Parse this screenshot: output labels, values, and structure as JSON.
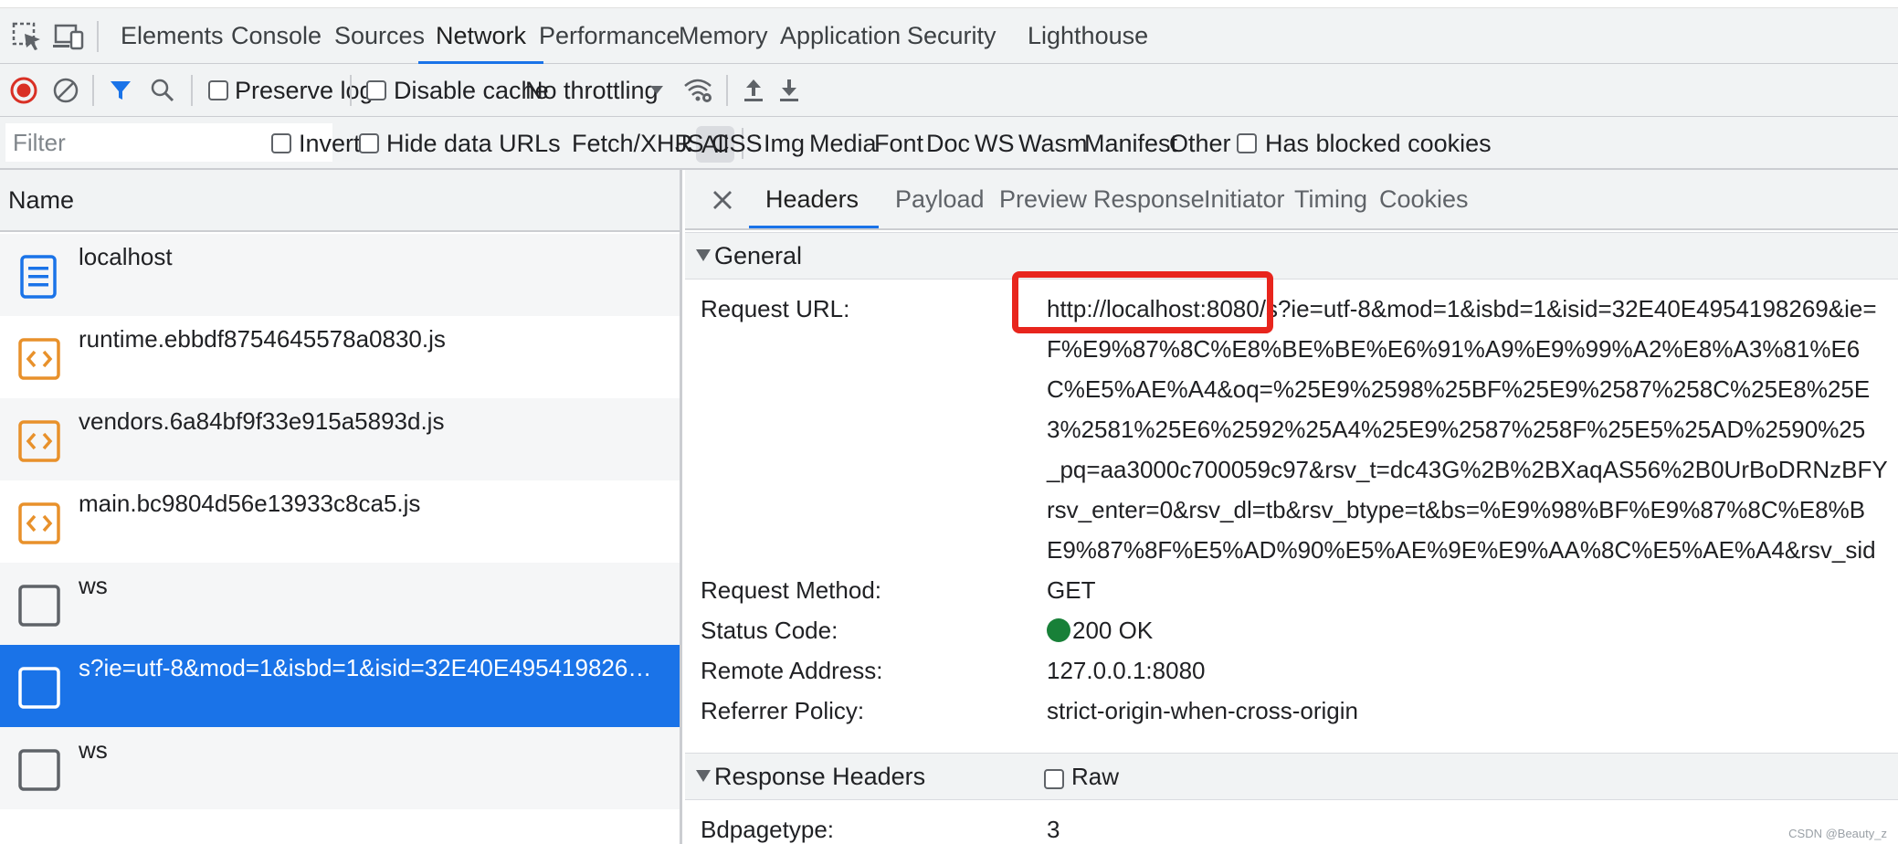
{
  "tabbar": {
    "tabs": [
      {
        "label": "Elements"
      },
      {
        "label": "Console"
      },
      {
        "label": "Sources"
      },
      {
        "label": "Network",
        "active": true
      },
      {
        "label": "Performance"
      },
      {
        "label": "Memory"
      },
      {
        "label": "Application"
      },
      {
        "label": "Security"
      },
      {
        "label": "Lighthouse"
      }
    ]
  },
  "toolbar": {
    "preserve_log_label": "Preserve log",
    "disable_cache_label": "Disable cache",
    "throttling_value": "No throttling",
    "preserve_log_checked": false,
    "disable_cache_checked": false
  },
  "filterbar": {
    "filter_placeholder": "Filter",
    "invert_label": "Invert",
    "hide_data_urls_label": "Hide data URLs",
    "type_filters": [
      "All",
      "Fetch/XHR",
      "JS",
      "CSS",
      "Img",
      "Media",
      "Font",
      "Doc",
      "WS",
      "Wasm",
      "Manifest",
      "Other"
    ],
    "has_blocked_cookies_label": "Has blocked cookies"
  },
  "request_list": {
    "header": "Name",
    "rows": [
      {
        "name": "localhost",
        "icon": "document-icon"
      },
      {
        "name": "runtime.ebbdf8754645578a0830.js",
        "icon": "script-icon"
      },
      {
        "name": "vendors.6a84bf9f33e915a5893d.js",
        "icon": "script-icon"
      },
      {
        "name": "main.bc9804d56e13933c8ca5.js",
        "icon": "script-icon"
      },
      {
        "name": "ws",
        "icon": "websocket-icon"
      },
      {
        "name": "s?ie=utf-8&mod=1&isbd=1&isid=32E40E495419826…",
        "icon": "fetch-icon",
        "selected": true
      },
      {
        "name": "ws",
        "icon": "websocket-icon"
      }
    ]
  },
  "details": {
    "tabs": [
      {
        "label": "Headers",
        "active": true
      },
      {
        "label": "Payload"
      },
      {
        "label": "Preview"
      },
      {
        "label": "Response"
      },
      {
        "label": "Initiator"
      },
      {
        "label": "Timing"
      },
      {
        "label": "Cookies"
      }
    ],
    "general": {
      "title": "General",
      "request_url_key": "Request URL:",
      "request_url_lines": [
        "http://localhost:8080/s?ie=utf-8&mod=1&isbd=1&isid=32E40E4954198269&ie=",
        "F%E9%87%8C%E8%BE%BE%E6%91%A9%E9%99%A2%E8%A3%81%E6",
        "C%E5%AE%A4&oq=%25E9%2598%25BF%25E9%2587%258C%25E8%25E",
        "3%2581%25E6%2592%25A4%25E9%2587%258F%25E5%25AD%2590%25",
        "_pq=aa3000c700059c97&rsv_t=dc43G%2B%2BXaqAS56%2B0UrBoDRNzBFY",
        "rsv_enter=0&rsv_dl=tb&rsv_btype=t&bs=%E9%98%BF%E9%87%8C%E8%B",
        "E9%87%8F%E5%AD%90%E5%AE%9E%E9%AA%8C%E5%AE%A4&rsv_sid"
      ],
      "request_method_key": "Request Method:",
      "request_method": "GET",
      "status_code_key": "Status Code:",
      "status_code": "200 OK",
      "remote_address_key": "Remote Address:",
      "remote_address": "127.0.0.1:8080",
      "referrer_policy_key": "Referrer Policy:",
      "referrer_policy": "strict-origin-when-cross-origin"
    },
    "response_headers": {
      "title": "Response Headers",
      "raw_label": "Raw",
      "bdpagetype_key": "Bdpagetype:",
      "bdpagetype": "3"
    }
  },
  "watermark": "CSDN @Beauty_z",
  "colors": {
    "accent": "#1a73e8",
    "record_red": "#d93025",
    "highlight_red": "#e8251d",
    "status_green": "#188038",
    "script_orange": "#e8912b"
  }
}
